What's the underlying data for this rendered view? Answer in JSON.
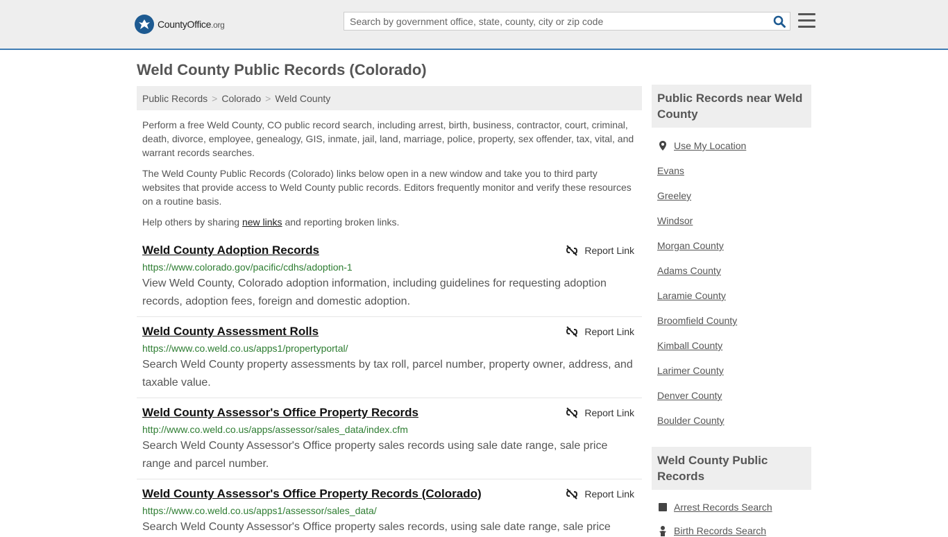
{
  "header": {
    "logo_brand": "CountyOffice",
    "logo_tld": ".org",
    "search_placeholder": "Search by government office, state, county, city or zip code"
  },
  "page_title": "Weld County Public Records (Colorado)",
  "breadcrumb": [
    "Public Records",
    "Colorado",
    "Weld County"
  ],
  "intro": {
    "p1": "Perform a free Weld County, CO public record search, including arrest, birth, business, contractor, court, criminal, death, divorce, employee, genealogy, GIS, inmate, jail, land, marriage, police, property, sex offender, tax, vital, and warrant records searches.",
    "p2": "The Weld County Public Records (Colorado) links below open in a new window and take you to third party websites that provide access to Weld County public records. Editors frequently monitor and verify these resources on a routine basis.",
    "p3_before": "Help others by sharing ",
    "p3_link": "new links",
    "p3_after": " and reporting broken links."
  },
  "report_label": "Report Link",
  "records": [
    {
      "title": "Weld County Adoption Records",
      "url": "https://www.colorado.gov/pacific/cdhs/adoption-1",
      "description": "View Weld County, Colorado adoption information, including guidelines for requesting adoption records, adoption fees, foreign and domestic adoption."
    },
    {
      "title": "Weld County Assessment Rolls",
      "url": "https://www.co.weld.co.us/apps1/propertyportal/",
      "description": "Search Weld County property assessments by tax roll, parcel number, property owner, address, and taxable value."
    },
    {
      "title": "Weld County Assessor's Office Property Records",
      "url": "http://www.co.weld.co.us/apps/assessor/sales_data/index.cfm",
      "description": "Search Weld County Assessor's Office property sales records using sale date range, sale price range and parcel number."
    },
    {
      "title": "Weld County Assessor's Office Property Records (Colorado)",
      "url": "https://www.co.weld.co.us/apps1/assessor/sales_data/",
      "description": "Search Weld County Assessor's Office property sales records, using sale date range, sale price"
    }
  ],
  "sidebar": {
    "nearby_title": "Public Records near Weld County",
    "use_location": "Use My Location",
    "nearby_links": [
      "Evans",
      "Greeley",
      "Windsor",
      "Morgan County",
      "Adams County",
      "Laramie County",
      "Broomfield County",
      "Kimball County",
      "Larimer County",
      "Denver County",
      "Boulder County"
    ],
    "county_title": "Weld County Public Records",
    "county_links": [
      "Arrest Records Search",
      "Birth Records Search"
    ]
  },
  "colors": {
    "header_bg": "#eeeeee",
    "header_border": "#3f7cb3",
    "logo_blue": "#1d5a91",
    "url_green": "#2e7d32"
  }
}
